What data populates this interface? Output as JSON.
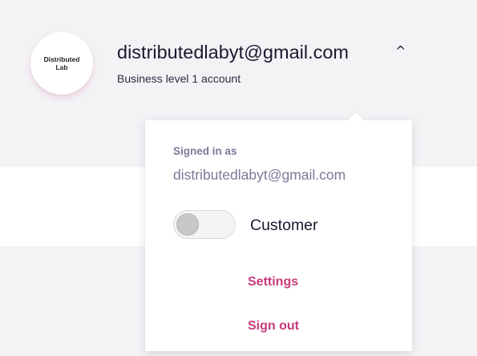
{
  "account": {
    "avatar_text_line1": "Distributed",
    "avatar_text_line2": "Lab",
    "email": "distributedlabyt@gmail.com",
    "level": "Business level 1 account",
    "chevron_icon": "chevron-up-icon"
  },
  "dropdown": {
    "signed_in_label": "Signed in as",
    "signed_in_email": "distributedlabyt@gmail.com",
    "toggle": {
      "label": "Customer",
      "on": false
    },
    "settings_label": "Settings",
    "signout_label": "Sign out"
  },
  "colors": {
    "accent": "#c73a7a",
    "muted_text": "#7a7a98",
    "panel_background": "#f3f3f6",
    "primary_text": "#1b1a2e"
  }
}
